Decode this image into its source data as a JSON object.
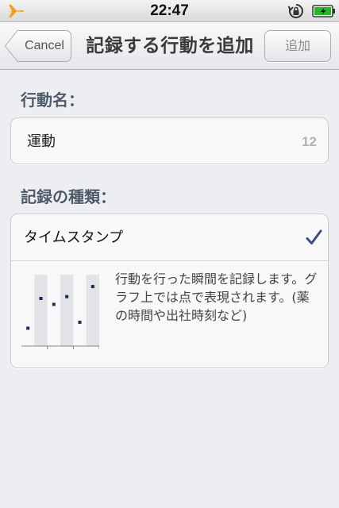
{
  "status_bar": {
    "time": "22:47",
    "airplane_mode": true,
    "orientation_lock": true,
    "battery": "charging"
  },
  "nav": {
    "cancel_label": "Cancel",
    "title": "記録する行動を追加",
    "add_label": "追加"
  },
  "form": {
    "name_section_label": "行動名：",
    "name_value": "運動",
    "name_remaining": "12",
    "type_section_label": "記録の種類：",
    "type_option_label": "タイムスタンプ",
    "type_option_selected": true,
    "type_description": "行動を行った瞬間を記録します。グラフ上では点で表現されます。(薬の時間や出社時刻など)"
  },
  "chart_data": {
    "type": "scatter",
    "x": [
      1,
      2,
      3,
      4,
      5,
      6
    ],
    "y": [
      0.3,
      0.8,
      0.7,
      0.83,
      0.4,
      1.0
    ],
    "columns": 6,
    "xlim": [
      0.5,
      6.5
    ],
    "ylim": [
      0,
      1.2
    ],
    "point_color": "#1e2a5a",
    "band_color": "#e2e3e6"
  },
  "colors": {
    "accent": "#3c4f80",
    "airplane": "#f0a020",
    "battery": "#28b628",
    "section_header": "#4d5868"
  },
  "icons": {
    "airplane": "airplane-icon",
    "lock": "orientation-lock-icon",
    "battery": "battery-charging-icon",
    "check": "checkmark-icon"
  }
}
